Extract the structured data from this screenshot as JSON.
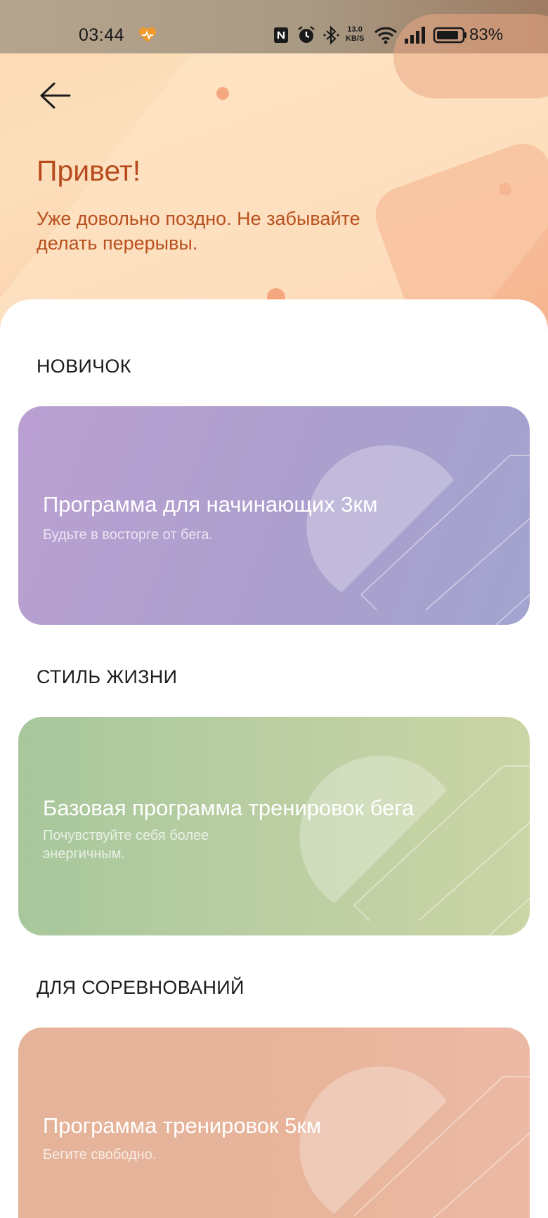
{
  "status_bar": {
    "time": "03:44",
    "speed_value": "13.0",
    "speed_unit": "KB/S",
    "battery_percent": "83%",
    "icons": [
      "heart-app-icon",
      "nfc-icon",
      "alarm-icon",
      "bluetooth-icon",
      "wifi-icon",
      "signal-icon",
      "battery-icon"
    ]
  },
  "header": {
    "greeting": "Привет!",
    "message": "Уже довольно поздно. Не забывайте делать перерывы."
  },
  "sections": [
    {
      "title": "НОВИЧОК",
      "card": {
        "title": "Программа для начинающих 3км",
        "subtitle": "Будьте в восторге от бега."
      }
    },
    {
      "title": "СТИЛЬ ЖИЗНИ",
      "card": {
        "title": "Базовая программа тренировок бега",
        "subtitle": "Почувствуйте себя более энергичным."
      }
    },
    {
      "title": "ДЛЯ СОРЕВНОВАНИЙ",
      "card": {
        "title": "Программа тренировок 5км",
        "subtitle": "Бегите свободно."
      }
    }
  ],
  "colors": {
    "accent": "#b84b1d",
    "card_beginner": "#ab9fcd",
    "card_lifestyle": "#bccfa3",
    "card_competition": "#e8b59b"
  }
}
